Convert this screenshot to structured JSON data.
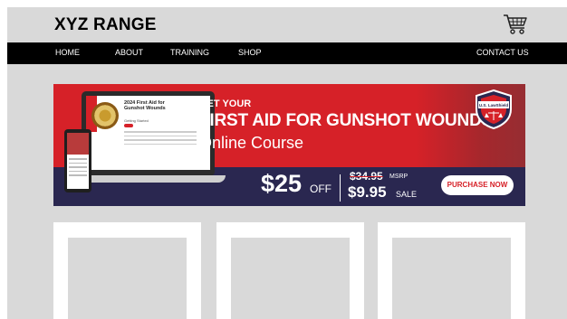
{
  "header": {
    "brand": "XYZ RANGE",
    "cart_icon": "shopping-cart-icon"
  },
  "nav": {
    "items": [
      "HOME",
      "ABOUT",
      "TRAINING",
      "SHOP"
    ],
    "contact": "CONTACT US"
  },
  "banner": {
    "kicker": "GET YOUR",
    "title": "FIRST AID FOR GUNSHOT WOUNDS",
    "subtitle": "Online Course",
    "price": "$25",
    "off": "OFF",
    "msrp_price": "$34.95",
    "msrp_label": "MSRP",
    "sale_price": "$9.95",
    "sale_label": "SALE",
    "cta": "PURCHASE NOW",
    "laptop_title": "2024 First Aid for Gunshot Wounds",
    "laptop_subtitle": "Getting Started",
    "badge_text": "U.S. LawShield",
    "colors": {
      "red": "#d62128",
      "navy": "#2a2750"
    }
  },
  "cards": [
    {},
    {},
    {}
  ]
}
